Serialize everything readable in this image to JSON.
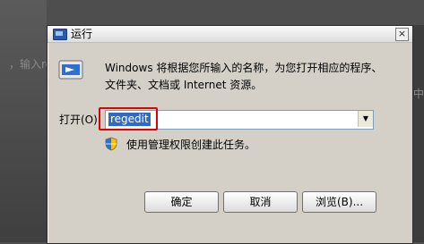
{
  "background": {
    "left_hint": "，输入rege",
    "right_hint": "框中"
  },
  "window": {
    "title": "运行",
    "close_glyph": "×",
    "description": "Windows 将根据您所输入的名称，为您打开相应的程序、文件夹、文档或 Internet 资源。",
    "open_label": "打开(O):",
    "open_value": "regedit",
    "combo_arrow_glyph": "▼",
    "admin_note": "使用管理权限创建此任务。",
    "buttons": {
      "ok": "确定",
      "cancel": "取消",
      "browse": "浏览(B)..."
    }
  },
  "colors": {
    "selection": "#316ac5",
    "highlight_box": "#e00000",
    "dialog_face": "#d4d0c8"
  },
  "icons": {
    "app": "run-app-icon",
    "run": "run-program-icon",
    "shield": "uac-shield-icon",
    "close": "close-icon",
    "dropdown": "chevron-down-icon"
  }
}
